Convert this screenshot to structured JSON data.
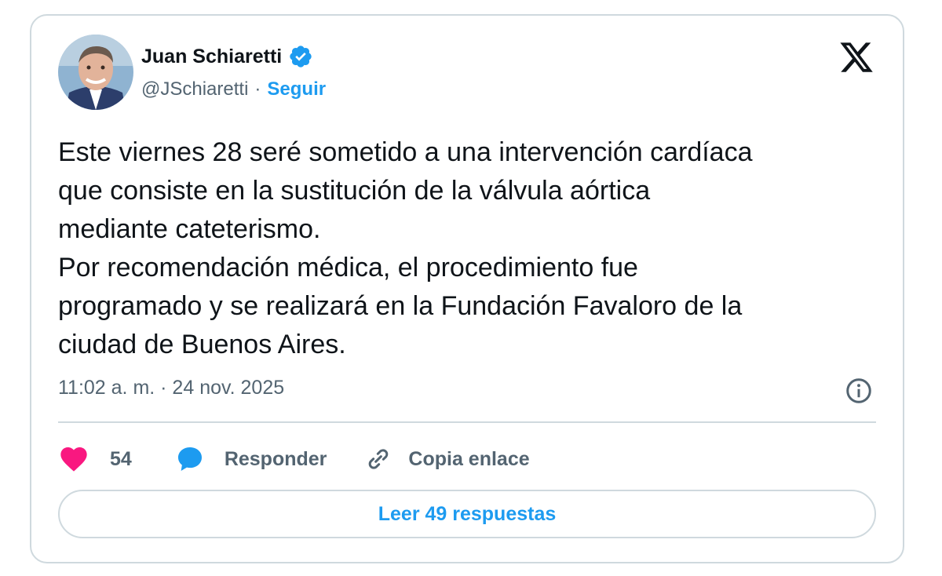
{
  "author": {
    "name": "Juan Schiaretti",
    "handle": "@JSchiaretti",
    "separator": "·",
    "follow_label": "Seguir",
    "verified_icon": "verified-badge-icon"
  },
  "tweet": {
    "text": "Este viernes 28 seré sometido a una intervención cardíaca\nque consiste en la sustitución de la válvula aórtica\nmediante cateterismo.\nPor recomendación médica, el procedimiento fue\nprogramado y se realizará en la Fundación Favaloro de la\nciudad de Buenos Aires.",
    "timestamp": "11:02 a. m. · 24 nov. 2025"
  },
  "actions": {
    "like_count": "54",
    "reply_label": "Responder",
    "copy_label": "Copia enlace"
  },
  "read_replies_label": "Leer 49 respuestas",
  "colors": {
    "accent": "#1d9bf0",
    "like": "#f91880",
    "text": "#0f1419",
    "muted": "#536471",
    "border": "#cfd9de"
  }
}
